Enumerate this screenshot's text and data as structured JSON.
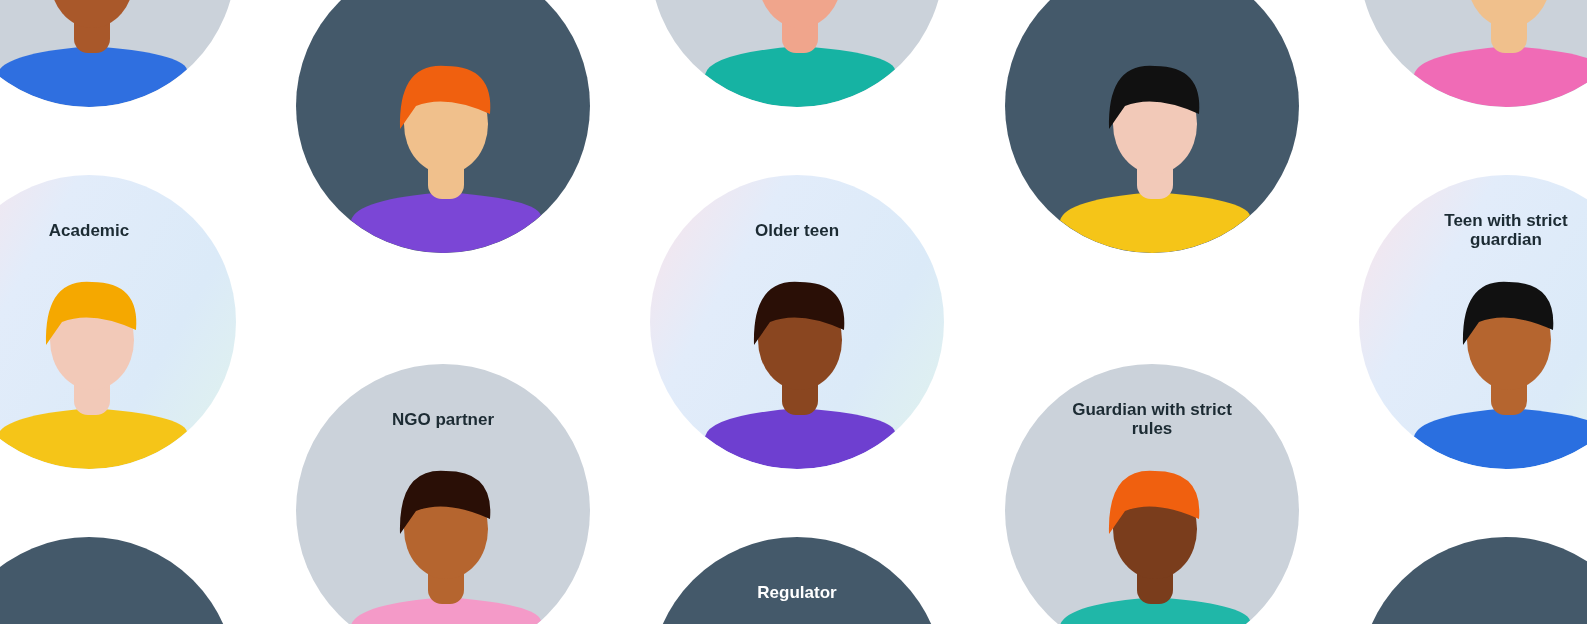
{
  "columns": [
    {
      "avatars": [
        {
          "kind": "gray",
          "color": "#2f6fe0"
        },
        {
          "kind": "gradient",
          "label": "Academic",
          "color": "#f5c518"
        },
        {
          "kind": "dark"
        }
      ]
    },
    {
      "avatars": [
        {
          "kind": "dark",
          "color": "#7b46d6"
        },
        {
          "kind": "gray",
          "label": "NGO partner",
          "color": "#f49ac8"
        }
      ]
    },
    {
      "avatars": [
        {
          "kind": "gray",
          "color": "#16b3a3"
        },
        {
          "kind": "gradient",
          "label": "Older teen",
          "color": "#6e3fd0"
        },
        {
          "kind": "dark",
          "label": "Regulator"
        }
      ]
    },
    {
      "avatars": [
        {
          "kind": "dark",
          "color": "#f5c518"
        },
        {
          "kind": "gray",
          "label": "Guardian with strict rules",
          "color": "#20b7a8"
        }
      ]
    },
    {
      "avatars": [
        {
          "kind": "gray",
          "color": "#f06bb6"
        },
        {
          "kind": "gradient",
          "label": "Teen with strict guardian",
          "color": "#2a6fe0"
        },
        {
          "kind": "dark"
        }
      ]
    }
  ]
}
